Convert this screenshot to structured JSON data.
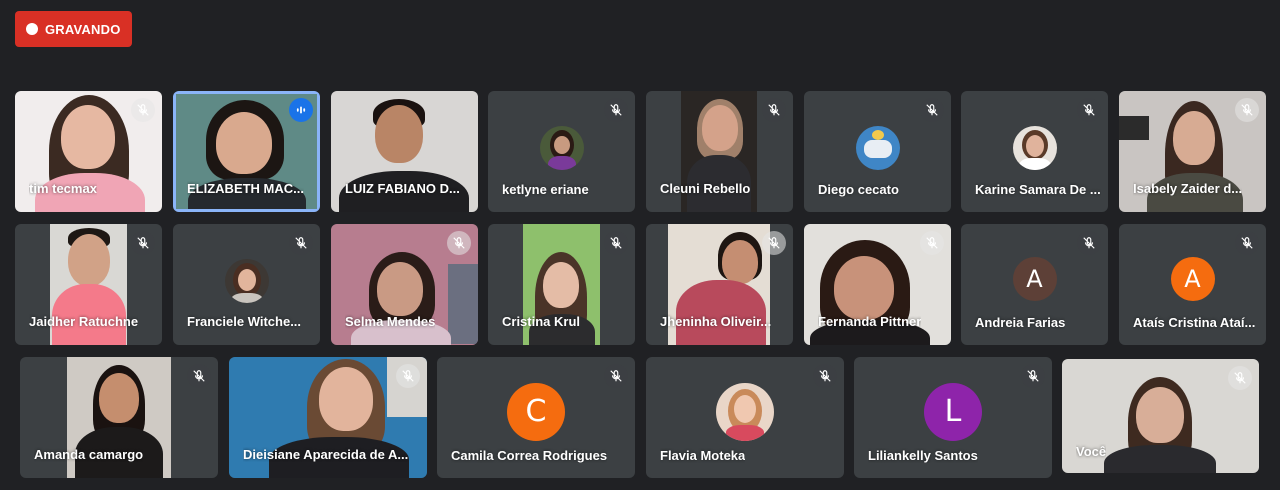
{
  "recording_label": "GRAVANDO",
  "colors": {
    "background": "#202124",
    "tile": "#3c4043",
    "recording": "#d93025",
    "speaking_border": "#8ab4f8",
    "speaking_icon": "#1a73e8"
  },
  "participants": [
    {
      "name": "tim tecmax",
      "muted": true,
      "type": "video"
    },
    {
      "name": "ELIZABETH MAC...",
      "muted": false,
      "speaking": true,
      "type": "video"
    },
    {
      "name": "LUIZ FABIANO D...",
      "muted": false,
      "type": "video"
    },
    {
      "name": "ketlyne eriane",
      "muted": true,
      "type": "photo"
    },
    {
      "name": "Cleuni Rebello",
      "muted": true,
      "type": "video"
    },
    {
      "name": "Diego cecato",
      "muted": true,
      "type": "photo"
    },
    {
      "name": "Karine Samara De ...",
      "muted": true,
      "type": "photo"
    },
    {
      "name": "Isabely Zaider d...",
      "muted": true,
      "type": "video"
    },
    {
      "name": "Jaidher Ratuchne",
      "muted": true,
      "type": "video"
    },
    {
      "name": "Franciele Witche...",
      "muted": true,
      "type": "photo"
    },
    {
      "name": "Selma Mendes",
      "muted": true,
      "type": "video"
    },
    {
      "name": "Cristina Krul",
      "muted": true,
      "type": "video"
    },
    {
      "name": "Jheninha Oliveir...",
      "muted": true,
      "type": "video"
    },
    {
      "name": "Fernanda Pittner",
      "muted": true,
      "type": "video"
    },
    {
      "name": "Andreia Farias",
      "muted": true,
      "type": "letter",
      "initial": "A"
    },
    {
      "name": "Ataís Cristina Ataí...",
      "muted": true,
      "type": "letter",
      "initial": "A"
    },
    {
      "name": "Amanda camargo",
      "muted": true,
      "type": "video"
    },
    {
      "name": "Dieisiane Aparecida de A...",
      "muted": true,
      "type": "video"
    },
    {
      "name": "Camila Correa Rodrigues",
      "muted": true,
      "type": "letter",
      "initial": "C"
    },
    {
      "name": "Flavia Moteka",
      "muted": true,
      "type": "photo"
    },
    {
      "name": "Liliankelly Santos",
      "muted": true,
      "type": "letter",
      "initial": "L"
    },
    {
      "name": "Você",
      "muted": true,
      "type": "video"
    }
  ]
}
